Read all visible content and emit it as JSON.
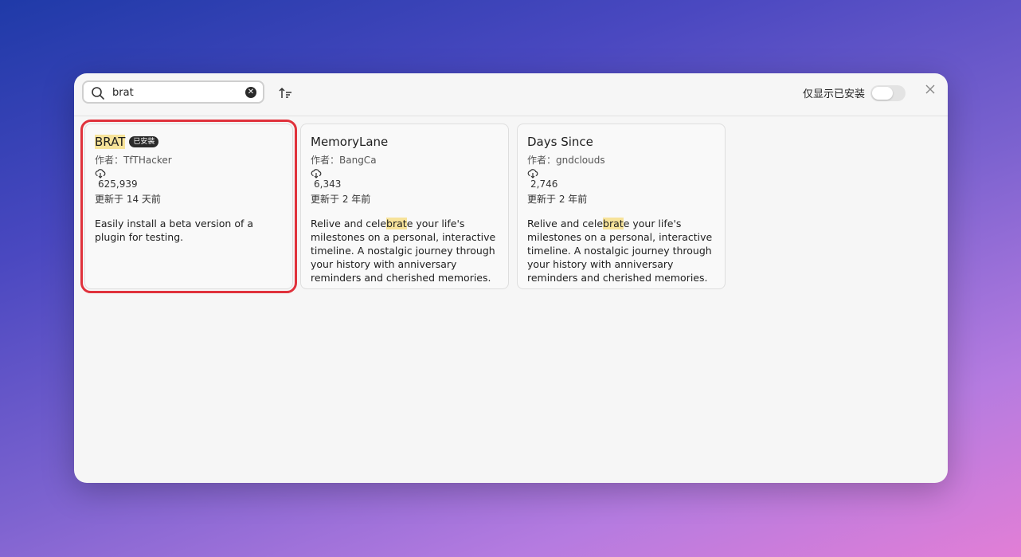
{
  "search": {
    "value": "brat",
    "placeholder": ""
  },
  "header": {
    "installed_only_label": "仅显示已安装"
  },
  "colors": {
    "highlight": "#f7e39a",
    "selection": "#e0323c",
    "badge_bg": "#2a2a2a"
  },
  "icons": {
    "search": "search-icon",
    "clear": "clear-icon",
    "sort": "sort-icon",
    "close": "close-icon",
    "download": "cloud-download-icon"
  },
  "cards": [
    {
      "title_highlight": "BRAT",
      "title_rest": "",
      "badge": "已安装",
      "author": "作者：TfTHacker",
      "downloads": "625,939",
      "updated": "更新于 14 天前",
      "desc_before": "Easily install a beta version of a plugin for testing.",
      "desc_highlight": "",
      "desc_after": ""
    },
    {
      "title_highlight": "",
      "title_rest": "MemoryLane",
      "badge": "",
      "author": "作者：BangCa",
      "downloads": "6,343",
      "updated": "更新于 2 年前",
      "desc_before": "Relive and cele",
      "desc_highlight": "brat",
      "desc_after": "e your life's milestones on a personal, interactive timeline. A nostalgic journey through your history with anniversary reminders and cherished memories."
    },
    {
      "title_highlight": "",
      "title_rest": "Days Since",
      "badge": "",
      "author": "作者：gndclouds",
      "downloads": "2,746",
      "updated": "更新于 2 年前",
      "desc_before": "Relive and cele",
      "desc_highlight": "brat",
      "desc_after": "e your life's milestones on a personal, interactive timeline. A nostalgic journey through your history with anniversary reminders and cherished memories."
    }
  ]
}
